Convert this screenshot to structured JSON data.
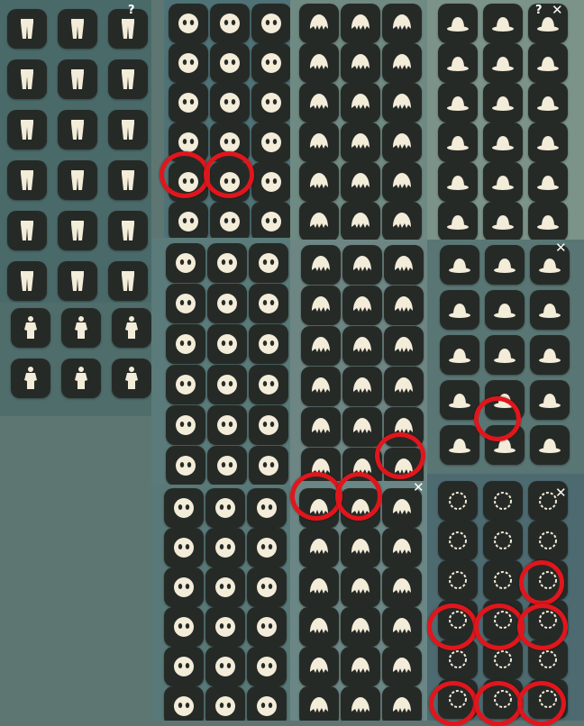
{
  "colors": {
    "tile_bg": "#262a27",
    "icon": "#f3ecd9",
    "highlight_ring": "#e0161c",
    "page_bg": "#5d7672"
  },
  "close_glyph": "✕",
  "help_glyph": "?",
  "panels": [
    {
      "name": "pants-panel",
      "bg": "#4a6a69",
      "cols": 3,
      "rows": 6,
      "icon": "pants"
    },
    {
      "name": "outfit-panel",
      "bg": "#4f6d6b",
      "cols": 3,
      "rows": 2,
      "icon": "outfit"
    },
    {
      "name": "mask-panel-1",
      "bg": "#4f7276",
      "cols": 3,
      "rows": 6,
      "icon": "mask"
    },
    {
      "name": "hair-panel-1",
      "bg": "#6f8a82",
      "cols": 3,
      "rows": 6,
      "icon": "hair"
    },
    {
      "name": "hat-panel-1",
      "bg": "#7b9389",
      "cols": 3,
      "rows": 6,
      "icon": "hat"
    },
    {
      "name": "mask-panel-2",
      "bg": "#5a7b7a",
      "cols": 3,
      "rows": 6,
      "icon": "mask"
    },
    {
      "name": "hair-panel-2",
      "bg": "#6d8684",
      "cols": 3,
      "rows": 6,
      "icon": "hair"
    },
    {
      "name": "hat-panel-2",
      "bg": "#597674",
      "cols": 3,
      "rows": 5,
      "icon": "hat"
    },
    {
      "name": "mask-panel-3",
      "bg": "#587978",
      "cols": 3,
      "rows": 6,
      "icon": "mask"
    },
    {
      "name": "hair-panel-3",
      "bg": "#6b8785",
      "cols": 3,
      "rows": 6,
      "icon": "hair"
    },
    {
      "name": "accessory-panel",
      "bg": "#4c6a70",
      "cols": 3,
      "rows": 6,
      "icon": "accessory"
    }
  ]
}
